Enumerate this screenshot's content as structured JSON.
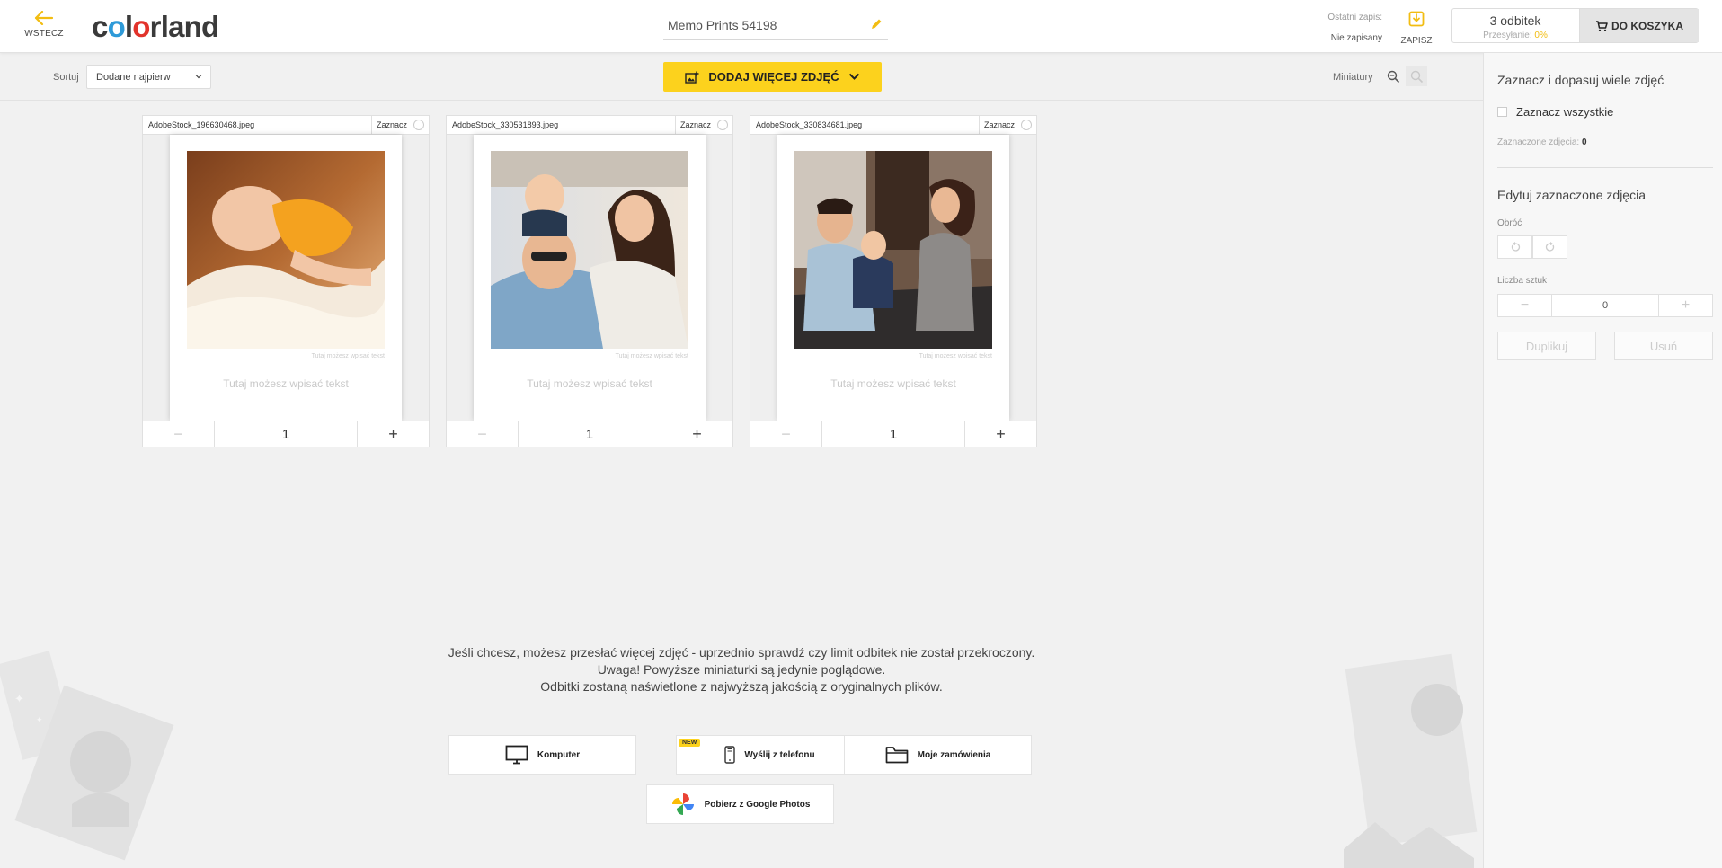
{
  "colors": {
    "accent": "#fcd21d",
    "logo_blue": "#2e9ad8",
    "logo_red": "#e2332b",
    "upload_pct": "#f2bd12"
  },
  "header": {
    "back_label": "WSTECZ",
    "back_icon": "arrow-left-icon",
    "logo": {
      "part1": "c",
      "o1": "o",
      "part2": "l",
      "o2": "o",
      "part3": "rland"
    },
    "project_name": "Memo Prints 54198",
    "edit_icon": "pencil-icon",
    "last_save_label": "Ostatni zapis:",
    "last_save_value": "Nie zapisany",
    "save_label": "ZAPISZ",
    "save_icon": "download-save-icon",
    "prints_count": "3 odbitek",
    "upload_label": "Przesyłanie:",
    "upload_value": "0%",
    "cart_label": "DO KOSZYKA",
    "cart_icon": "cart-icon"
  },
  "toolbar": {
    "sort_label": "Sortuj",
    "sort_value": "Dodane najpierw",
    "add_photos_label": "DODAJ WIĘCEJ ZDJĘĆ",
    "thumbnails_label": "Miniatury"
  },
  "photos": [
    {
      "filename": "AdobeStock_196630468.jpeg",
      "select_label": "Zaznacz",
      "caption_small": "Tutaj możesz wpisać tekst",
      "caption_main": "Tutaj możesz wpisać tekst",
      "quantity": "1"
    },
    {
      "filename": "AdobeStock_330531893.jpeg",
      "select_label": "Zaznacz",
      "caption_small": "Tutaj możesz wpisać tekst",
      "caption_main": "Tutaj możesz wpisać tekst",
      "quantity": "1"
    },
    {
      "filename": "AdobeStock_330834681.jpeg",
      "select_label": "Zaznacz",
      "caption_small": "Tutaj możesz wpisać tekst",
      "caption_main": "Tutaj możesz wpisać tekst",
      "quantity": "1"
    }
  ],
  "info": {
    "line1": "Jeśli chcesz, możesz przesłać więcej zdjęć - uprzednio sprawdź czy limit odbitek nie został przekroczony.",
    "line2": "Uwaga! Powyższe miniaturki są jedynie poglądowe.",
    "line3": "Odbitki zostaną naświetlone z najwyższą jakością z oryginalnych plików."
  },
  "sources": {
    "computer": "Komputer",
    "phone": "Wyślij z telefonu",
    "phone_badge": "NEW",
    "orders": "Moje zamówienia",
    "google": "Pobierz z Google Photos"
  },
  "panel": {
    "title": "Zaznacz i dopasuj wiele zdjęć",
    "select_all": "Zaznacz wszystkie",
    "selected_label": "Zaznaczone zdjęcia:",
    "selected_count": "0",
    "edit_title": "Edytuj zaznaczone zdjęcia",
    "rotate_label": "Obróć",
    "qty_label": "Liczba sztuk",
    "qty_value": "0",
    "duplicate_label": "Duplikuj",
    "delete_label": "Usuń"
  }
}
